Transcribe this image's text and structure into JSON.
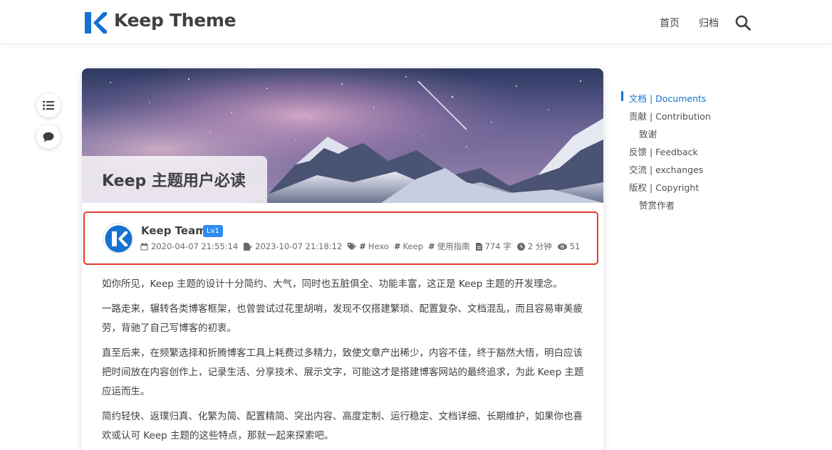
{
  "header": {
    "site_name": "Keep Theme",
    "nav": [
      "首页",
      "归档"
    ],
    "icons": {
      "logo": "keep-logo",
      "search": "search-icon"
    },
    "brand_color": "#1472d1"
  },
  "tools": {
    "toc": "list-icon",
    "comment": "comment-icon"
  },
  "post": {
    "title": "Keep 主题用户必读",
    "author": "Keep Team",
    "level": "Lv1",
    "created": "2020-04-07 21:55:14",
    "updated": "2023-10-07 21:18:12",
    "tags": [
      "Hexo",
      "Keep",
      "使用指南"
    ],
    "word_count": "774 字",
    "read_time": "2 分钟",
    "views": "51",
    "paragraphs": [
      "如你所见，Keep 主题的设计十分简约、大气，同时也五脏俱全、功能丰富，这正是 Keep 主题的开发理念。",
      "一路走来，辗转各类博客框架，也曾尝试过花里胡哨，发现不仅搭建繁琐、配置复杂、文档混乱，而且容易审美疲劳，背驰了自己写博客的初衷。",
      "直至后来，在频繁选择和折腾博客工具上耗费过多精力，致使文章产出稀少，内容不佳，终于豁然大悟，明白应该把时间放在内容创作上，记录生活、分享技术、展示文字，可能这才是搭建博客网站的最终追求，为此 Keep 主题应运而生。",
      "简约轻快、返璞归真、化繁为简、配置精简、突出内容、高度定制、运行稳定、文档详细、长期维护，如果你也喜欢或认可 Keep 主题的这些特点，那就一起来探索吧。"
    ],
    "highlight_color": "#e53b2c"
  },
  "toc": [
    {
      "label": "文档 | Documents",
      "active": true
    },
    {
      "label": "贡献 | Contribution",
      "active": false
    },
    {
      "label": "致谢",
      "active": false
    },
    {
      "label": "反馈 | Feedback",
      "active": false
    },
    {
      "label": "交流 | exchanges",
      "active": false
    },
    {
      "label": "版权 | Copyright",
      "active": false
    },
    {
      "label": "赞赏作者",
      "active": false
    }
  ]
}
